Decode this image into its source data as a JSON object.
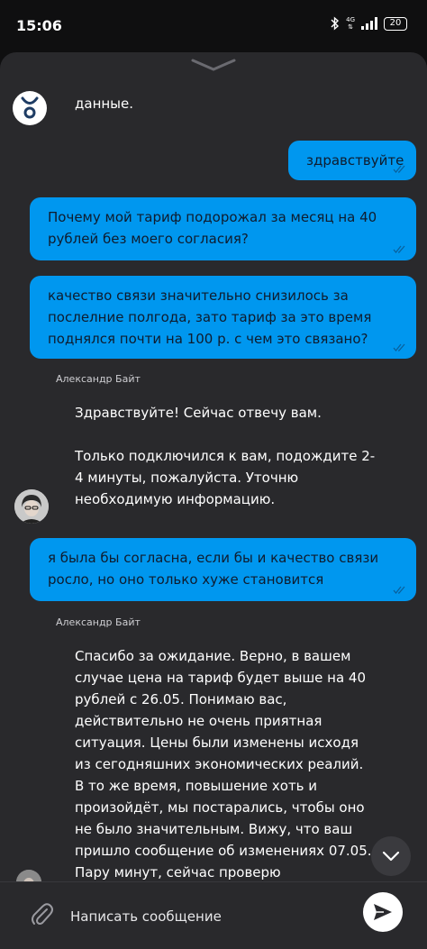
{
  "status": {
    "time": "15:06",
    "network": "4G",
    "battery": "20"
  },
  "chat": {
    "bot_message_tail": "данные.",
    "messages_user": [
      "здравствуйте",
      "Почему мой тариф подорожал за месяц на 40 рублей без моего согласия?",
      "качество связи значительно снизилось за послелние полгода, зато тариф за это время поднялся почти на 100 р. с чем это связано?",
      "я была бы согласна, если бы и качество связи росло, но оно только хуже становится"
    ],
    "agent_name": "Александр Байт",
    "agent_reply_1": "Здравствуйте! Сейчас отвечу вам.\n\nТолько подключился к вам, подождите 2-4 минуты, пожалуйста. Уточню необходимую информацию.",
    "agent_reply_2": "Спасибо за ожидание. Верно, в вашем случае цена на тариф будет выше на 40 рублей с 26.05. Понимаю вас, действительно не очень приятная ситуация. Цены были изменены исходя из сегодняшних экономических реалий. В то же время, повышение хоть и произойдёт, мы постарались, чтобы оно не было значительным. Вижу, что ваш пришло сообщение об изменениях 07.05.\nПару минут, сейчас проверю подключение"
  },
  "composer": {
    "placeholder": "Написать сообщение"
  },
  "colors": {
    "user_bubble": "#0097ef",
    "background": "#29292c"
  }
}
